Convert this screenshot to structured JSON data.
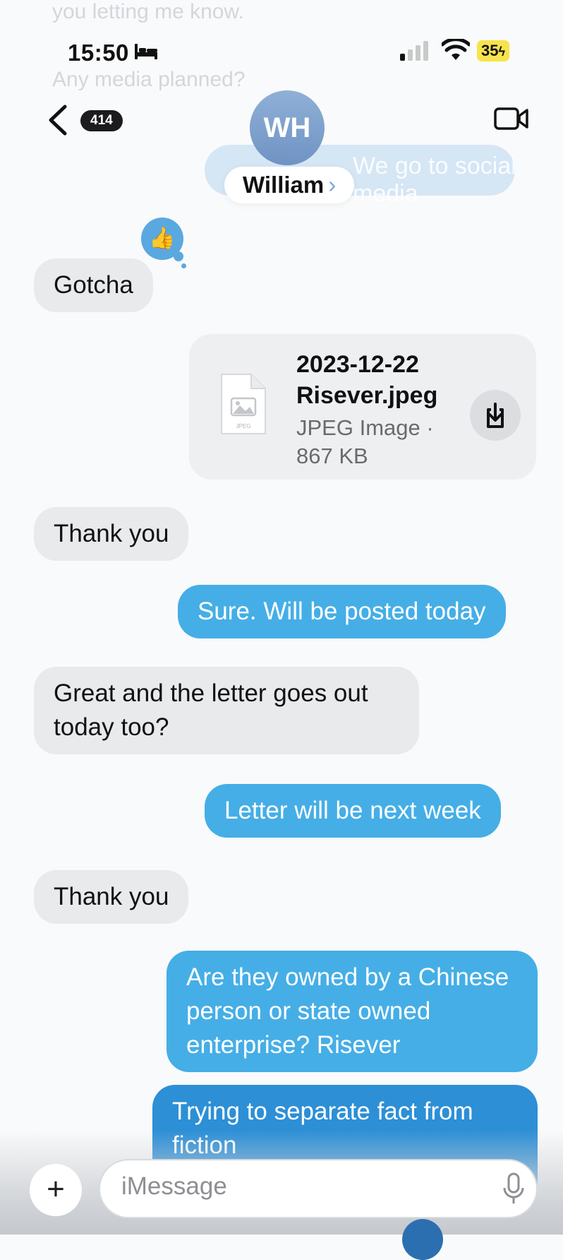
{
  "ghost": {
    "line1": "you letting me know.",
    "line2": "Any media planned?",
    "line3": "We go to social media"
  },
  "status_bar": {
    "time": "15:50",
    "battery": "35"
  },
  "nav": {
    "unread_count": "414",
    "contact_initials": "WH",
    "contact_name": "William",
    "contact_chevron": "›"
  },
  "colors": {
    "outgoing_bubble": "#45aee6",
    "incoming_bubble": "#e9eaec",
    "battery_low_power": "#f7e34b"
  },
  "messages": [
    {
      "side": "in",
      "text": "Gotcha",
      "tapback": "thumbs-up"
    },
    {
      "side": "in",
      "type": "file",
      "file_name": "2023-12-22 Risever.jpeg",
      "file_meta": "JPEG Image · 867 KB",
      "file_icon_label": "JPEG"
    },
    {
      "side": "in",
      "text": "Thank you"
    },
    {
      "side": "out",
      "text": "Sure. Will be posted today"
    },
    {
      "side": "in",
      "text": "Great and the letter goes out today too?"
    },
    {
      "side": "out",
      "text": "Letter will be next week"
    },
    {
      "side": "in",
      "text": "Thank you"
    },
    {
      "side": "out",
      "text": "Are they owned by a Chinese person or state owned enterprise?  Risever"
    },
    {
      "side": "out",
      "text": "Trying to separate fact from fiction"
    }
  ],
  "composer": {
    "placeholder": "iMessage",
    "plus_label": "+"
  },
  "icons": {
    "back": "chevron-left-icon",
    "facetime": "video-camera-icon",
    "download": "download-icon",
    "mic": "microphone-icon",
    "tapback": "thumbs-up-icon"
  }
}
